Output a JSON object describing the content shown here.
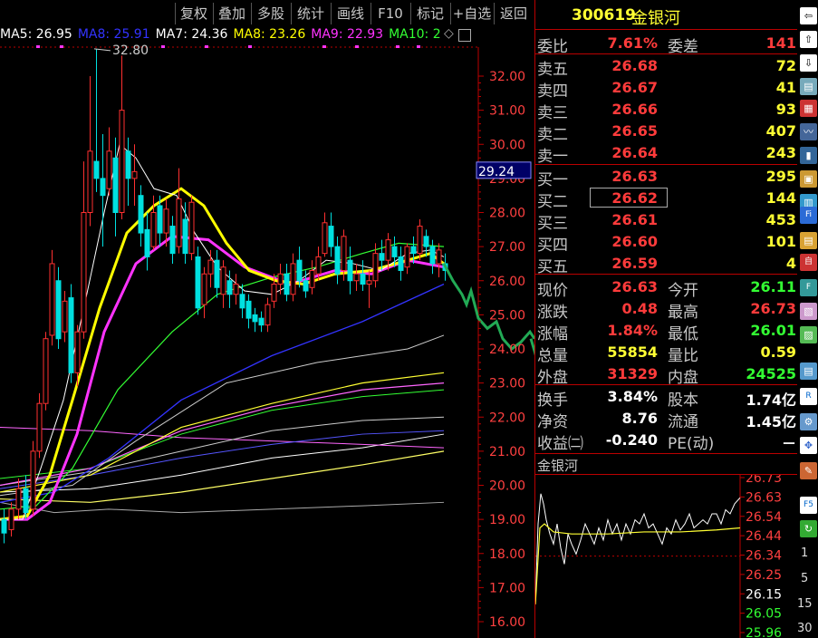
{
  "toolbar": {
    "buttons": [
      "复权",
      "叠加",
      "多股",
      "统计",
      "画线",
      "F10",
      "标记",
      "+自选",
      "返回"
    ]
  },
  "ma_legend": [
    {
      "label": "MA5: 26.95",
      "color": "#ffffff"
    },
    {
      "label": "MA8: 25.91",
      "color": "#3333ff"
    },
    {
      "label": "MA7: 24.36",
      "color": "#ffffff"
    },
    {
      "label": "MA8: 23.26",
      "color": "#ffff00"
    },
    {
      "label": "MA9: 22.93",
      "color": "#ff33ff"
    },
    {
      "label": "MA10: 2",
      "color": "#33ff33"
    }
  ],
  "chart": {
    "peak_label": "32.80",
    "price_labels": [
      "32.00",
      "31.00",
      "30.00",
      "29.00",
      "28.00",
      "27.00",
      "26.00",
      "25.00",
      "24.00",
      "23.00",
      "22.00",
      "21.00",
      "20.00",
      "19.00",
      "18.00",
      "17.00",
      "16.00"
    ],
    "cursor_price": "29.24"
  },
  "stock": {
    "code": "300619",
    "name": "金银河"
  },
  "order_book": {
    "wei_bi_label": "委比",
    "wei_bi": "7.61%",
    "wei_cha_label": "委差",
    "wei_cha": "141",
    "asks": [
      {
        "label": "卖五",
        "price": "26.68",
        "vol": "72"
      },
      {
        "label": "卖四",
        "price": "26.67",
        "vol": "41"
      },
      {
        "label": "卖三",
        "price": "26.66",
        "vol": "93"
      },
      {
        "label": "卖二",
        "price": "26.65",
        "vol": "407"
      },
      {
        "label": "卖一",
        "price": "26.64",
        "vol": "243"
      }
    ],
    "bids": [
      {
        "label": "买一",
        "price": "26.63",
        "vol": "295"
      },
      {
        "label": "买二",
        "price": "26.62",
        "vol": "144"
      },
      {
        "label": "买三",
        "price": "26.61",
        "vol": "453"
      },
      {
        "label": "买四",
        "price": "26.60",
        "vol": "101"
      },
      {
        "label": "买五",
        "price": "26.59",
        "vol": "4"
      }
    ]
  },
  "quote": [
    {
      "l1": "现价",
      "v1": "26.63",
      "c1": "red",
      "l2": "今开",
      "v2": "26.11",
      "c2": "grn"
    },
    {
      "l1": "涨跌",
      "v1": "0.48",
      "c1": "red",
      "l2": "最高",
      "v2": "26.73",
      "c2": "red"
    },
    {
      "l1": "涨幅",
      "v1": "1.84%",
      "c1": "red",
      "l2": "最低",
      "v2": "26.01",
      "c2": "grn"
    },
    {
      "l1": "总量",
      "v1": "55854",
      "c1": "yel",
      "l2": "量比",
      "v2": "0.59",
      "c2": "yel"
    },
    {
      "l1": "外盘",
      "v1": "31329",
      "c1": "red",
      "l2": "内盘",
      "v2": "24525",
      "c2": "grn"
    }
  ],
  "fundamentals": [
    {
      "l1": "换手",
      "v1": "3.84%",
      "l2": "股本",
      "v2": "1.74亿"
    },
    {
      "l1": "净资",
      "v1": "8.76",
      "l2": "流通",
      "v2": "1.45亿"
    },
    {
      "l1": "收益㈡",
      "v1": "-0.240",
      "l2": "PE(动)",
      "v2": "－"
    }
  ],
  "intraday": {
    "title": "金银河",
    "price_labels": [
      "26.73",
      "26.63",
      "26.54",
      "26.44",
      "26.34",
      "26.25",
      "26.15",
      "26.05",
      "25.96"
    ]
  },
  "sidebar": {
    "labels": [
      "1",
      "5",
      "15",
      "30"
    ]
  }
}
